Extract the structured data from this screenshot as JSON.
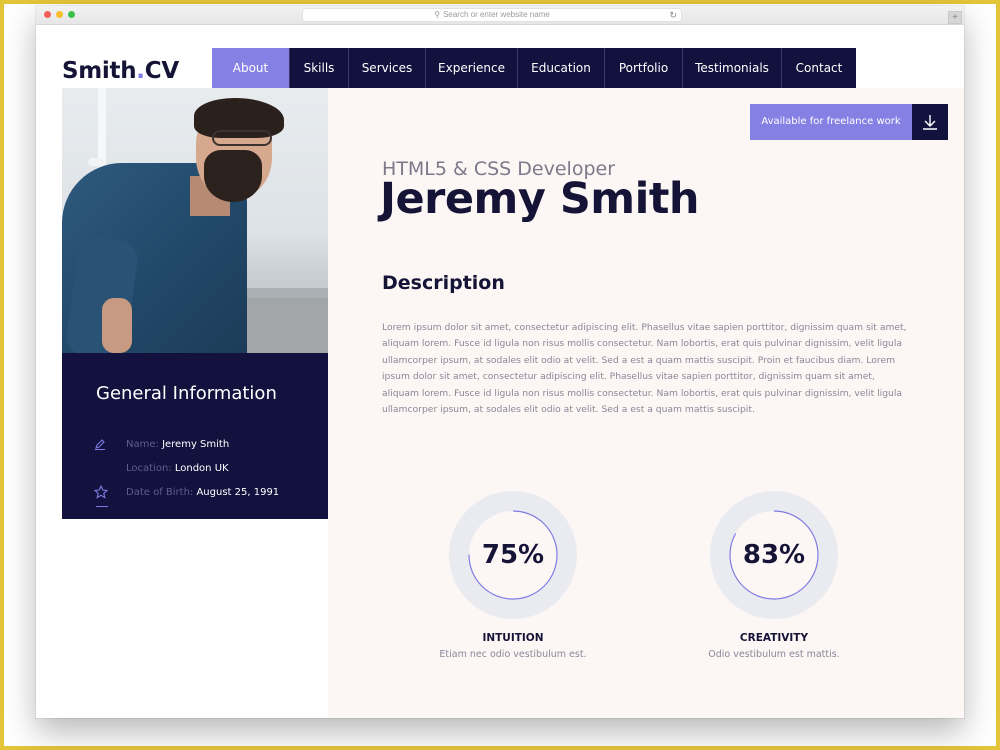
{
  "browser": {
    "url_placeholder": "Search or enter website name",
    "search_icon": "magnifier-icon",
    "reload_icon": "reload-icon",
    "new_tab_label": "+"
  },
  "header": {
    "logo_main": "Smith",
    "logo_dot": ".",
    "logo_suffix": "CV",
    "nav": [
      {
        "label": "About",
        "active": true
      },
      {
        "label": "Skills",
        "active": false
      },
      {
        "label": "Services",
        "active": false
      },
      {
        "label": "Experience",
        "active": false
      },
      {
        "label": "Education",
        "active": false
      },
      {
        "label": "Portfolio",
        "active": false
      },
      {
        "label": "Testimonials",
        "active": false
      },
      {
        "label": "Contact",
        "active": false
      }
    ]
  },
  "profile": {
    "photo_alt": "Portrait of Jeremy Smith",
    "info_title": "General Information",
    "info": [
      {
        "label": "Name:",
        "value": "Jeremy Smith",
        "icon": "pencil-icon"
      },
      {
        "label": "Location:",
        "value": "London UK",
        "icon": ""
      },
      {
        "label": "Date of Birth:",
        "value": "August 25, 1991",
        "icon": "star-icon"
      }
    ]
  },
  "hero": {
    "freelance_label": "Available for freelance work",
    "freelance_icon": "download-icon",
    "subtitle": "HTML5 & CSS Developer",
    "name": "Jeremy Smith",
    "description_title": "Description",
    "description": "Lorem ipsum dolor sit amet, consectetur adipiscing elit. Phasellus vitae sapien porttitor, dignissim quam sit amet, aliquam lorem. Fusce id ligula non risus mollis consectetur. Nam lobortis, erat quis pulvinar dignissim, velit ligula ullamcorper ipsum, at sodales elit odio at velit. Sed a est a quam mattis suscipit. Proin et faucibus diam. Lorem ipsum dolor sit amet, consectetur adipiscing elit. Phasellus vitae sapien porttitor, dignissim quam sit amet, aliquam lorem. Fusce id ligula non risus mollis consectetur. Nam lobortis, erat quis pulvinar dignissim, velit ligula ullamcorper ipsum, at sodales elit odio at velit. Sed a est a quam mattis suscipit."
  },
  "skills": [
    {
      "percent_label": "75%",
      "value": 0.75,
      "name": "INTUITION",
      "desc": "Etiam nec odio vestibulum est."
    },
    {
      "percent_label": "83%",
      "value": 0.83,
      "name": "CREATIVITY",
      "desc": "Odio vestibulum est mattis."
    }
  ],
  "colors": {
    "navy": "#13123f",
    "accent": "#8580e3",
    "ring_track": "#e9ebf1",
    "ring_progress": "#7f7be0"
  }
}
